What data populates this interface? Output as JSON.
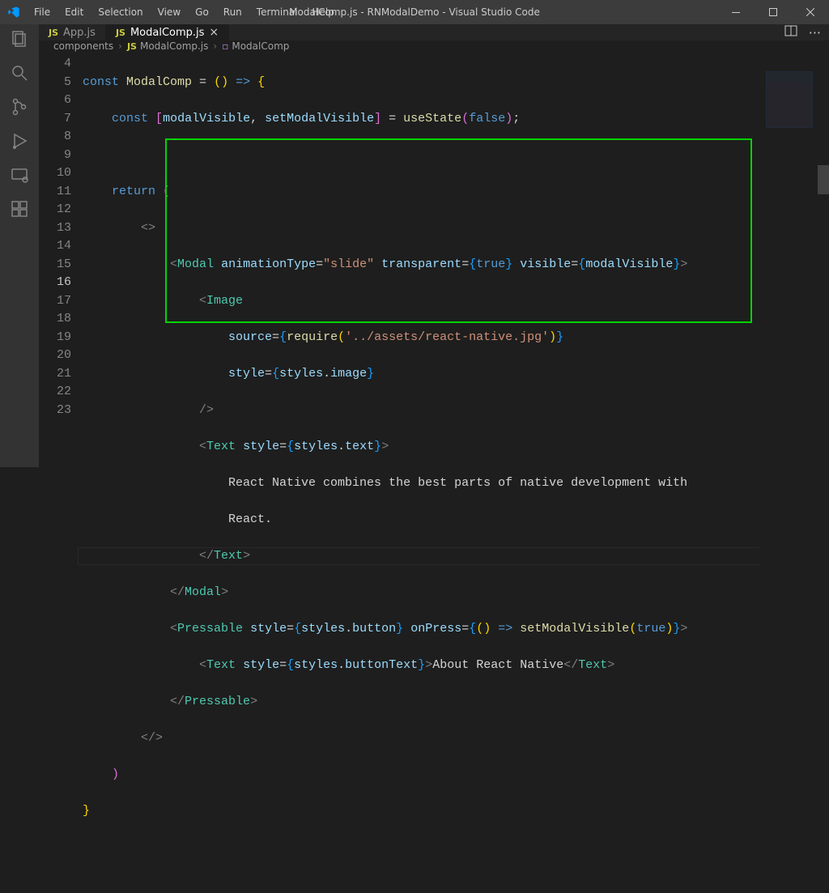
{
  "title": "ModalComp.js - RNModalDemo - Visual Studio Code",
  "menu": [
    "File",
    "Edit",
    "Selection",
    "View",
    "Go",
    "Run",
    "Terminal",
    "Help"
  ],
  "tabs": [
    {
      "icon": "JS",
      "label": "App.js",
      "active": false,
      "close": false
    },
    {
      "icon": "JS",
      "label": "ModalComp.js",
      "active": true,
      "close": true
    }
  ],
  "breadcrumbs": {
    "seg1": "components",
    "seg2": "ModalComp.js",
    "seg3": "ModalComp",
    "seg2icon": "JS"
  },
  "gutter": [
    "4",
    "5",
    "6",
    "7",
    "8",
    "9",
    "10",
    "11",
    "12",
    "13",
    "14",
    "15",
    "",
    "16",
    "17",
    "18",
    "19",
    "20",
    "21",
    "22",
    "23"
  ],
  "currentLine": "16",
  "code": {
    "l4": {
      "kw": "const",
      "sp": " ",
      "fn": "ModalComp",
      "eq": " = ",
      "paren": "()",
      "arrow": " => ",
      "brace": "{"
    },
    "l5": {
      "kw": "const",
      "sp": " ",
      "lb": "[",
      "v1": "modalVisible",
      "c": ", ",
      "v2": "setModalVisible",
      "rb": "]",
      "eq": " = ",
      "fn": "useState",
      "lp": "(",
      "bool": "false",
      "rp": ")",
      "semi": ";"
    },
    "l7": {
      "kw": "return",
      "sp": " ",
      "lp": "("
    },
    "l8": {
      "frag": "<>"
    },
    "l9": {
      "lt": "<",
      "tag": "Modal",
      "sp": " ",
      "a1": "animationType",
      "eq1": "=",
      "str1": "\"slide\"",
      "sp2": " ",
      "a2": "transparent",
      "eq2": "=",
      "lb2": "{",
      "bool2": "true",
      "rb2": "}",
      "sp3": " ",
      "a3": "visible",
      "eq3": "=",
      "lb3": "{",
      "var3": "modalVisible",
      "rb3": "}",
      "gt": ">"
    },
    "l10": {
      "lt": "<",
      "tag": "Image"
    },
    "l11": {
      "a": "source",
      "eq": "=",
      "lb": "{",
      "fn": "require",
      "lp": "(",
      "str": "'../assets/react-native.jpg'",
      "rp": ")",
      "rb": "}"
    },
    "l12": {
      "a": "style",
      "eq": "=",
      "lb": "{",
      "v1": "styles",
      "dot": ".",
      "v2": "image",
      "rb": "}"
    },
    "l13": {
      "close": "/>"
    },
    "l14": {
      "lt": "<",
      "tag": "Text",
      "sp": " ",
      "a": "style",
      "eq": "=",
      "lb": "{",
      "v1": "styles",
      "dot": ".",
      "v2": "text",
      "rb": "}",
      "gt": ">"
    },
    "l15": {
      "txt": "React Native combines the best parts of native development with "
    },
    "l15b": {
      "txt": "React."
    },
    "l16": {
      "lt": "</",
      "tag": "Text",
      "gt": ">"
    },
    "l17": {
      "lt": "</",
      "tag": "Modal",
      "gt": ">"
    },
    "l18": {
      "lt": "<",
      "tag": "Pressable",
      "sp": " ",
      "a1": "style",
      "eq1": "=",
      "lb1": "{",
      "v1a": "styles",
      "dot1": ".",
      "v1b": "button",
      "rb1": "}",
      "sp2": " ",
      "a2": "onPress",
      "eq2": "=",
      "lb2": "{",
      "lp": "()",
      "arrow": " => ",
      "fn": "setModalVisible",
      "lp2": "(",
      "bool": "true",
      "rp2": ")",
      "rb2": "}",
      "gt": ">"
    },
    "l19": {
      "lt": "<",
      "tag": "Text",
      "sp": " ",
      "a": "style",
      "eq": "=",
      "lb": "{",
      "v1": "styles",
      "dot": ".",
      "v2": "buttonText",
      "rb": "}",
      "gt": ">",
      "txt": "About React Native",
      "lt2": "</",
      "tag2": "Text",
      "gt2": ">"
    },
    "l20": {
      "lt": "</",
      "tag": "Pressable",
      "gt": ">"
    },
    "l21": {
      "frag": "</>"
    },
    "l22": {
      "rp": ")"
    },
    "l23": {
      "rb": "}"
    }
  }
}
